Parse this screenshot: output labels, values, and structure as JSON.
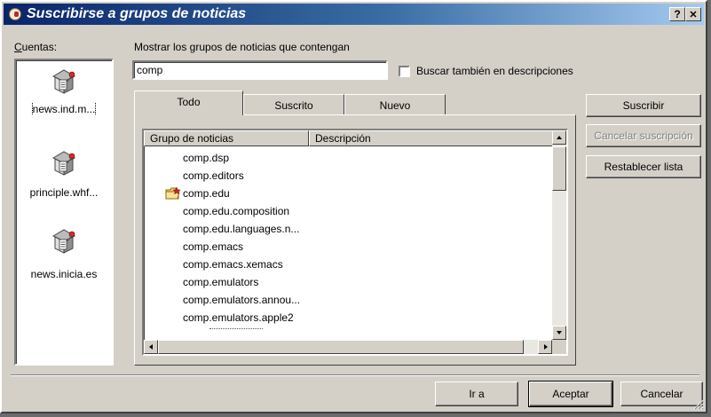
{
  "window": {
    "title": "Suscribirse a grupos de noticias",
    "help_button": "?",
    "close_button": "✕"
  },
  "accounts": {
    "label": "Cuentas:",
    "items": [
      {
        "label": "news.ind.m..."
      },
      {
        "label": "principle.whf..."
      },
      {
        "label": "news.inicia.es"
      }
    ]
  },
  "filter": {
    "label": "Mostrar los grupos de noticias que contengan",
    "value": "comp",
    "checkbox_label": "Buscar también en descripciones",
    "checked": false
  },
  "tabs": [
    {
      "label": "Todo",
      "active": true
    },
    {
      "label": "Suscrito",
      "active": false
    },
    {
      "label": "Nuevo",
      "active": false
    }
  ],
  "list": {
    "columns": [
      "Grupo de noticias",
      "Descripción"
    ],
    "rows": [
      {
        "name": "comp.dsp",
        "subscribed": false
      },
      {
        "name": "comp.editors",
        "subscribed": false
      },
      {
        "name": "comp.edu",
        "subscribed": true
      },
      {
        "name": "comp.edu.composition",
        "subscribed": false
      },
      {
        "name": "comp.edu.languages.n...",
        "subscribed": false
      },
      {
        "name": "comp.emacs",
        "subscribed": false
      },
      {
        "name": "comp.emacs.xemacs",
        "subscribed": false
      },
      {
        "name": "comp.emulators",
        "subscribed": false
      },
      {
        "name": "comp.emulators.annou...",
        "subscribed": false
      },
      {
        "name": "comp.emulators.apple2",
        "subscribed": false
      }
    ]
  },
  "side_buttons": {
    "subscribe": "Suscribir",
    "unsubscribe": "Cancelar suscripción",
    "reset": "Restablecer lista"
  },
  "footer_buttons": {
    "go": "Ir a",
    "ok": "Aceptar",
    "cancel": "Cancelar"
  }
}
